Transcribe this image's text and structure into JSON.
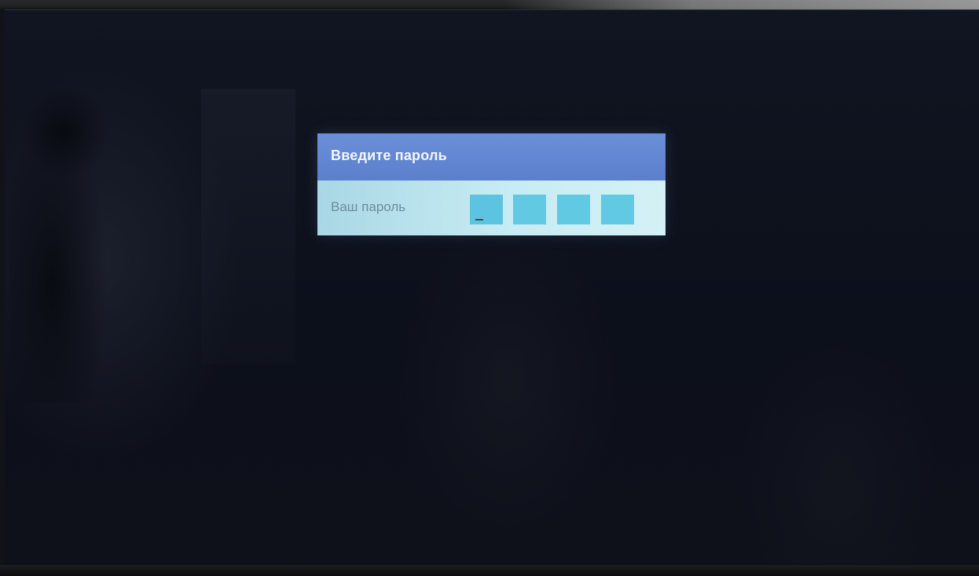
{
  "dialog": {
    "title": "Введите пароль",
    "field_label": "Ваш пароль",
    "pin_length": 4,
    "entered_digits": 0,
    "pins": [
      "",
      "",
      "",
      ""
    ]
  },
  "colors": {
    "header": "#5b7fcb",
    "body": "#c7ecf3",
    "pin_box": "#62c9e2",
    "screen_background": "#0c101b"
  }
}
